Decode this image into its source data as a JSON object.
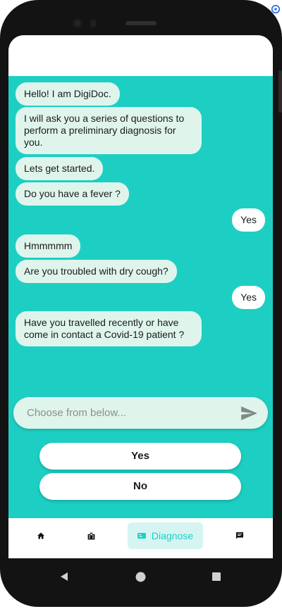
{
  "chat": {
    "messages": [
      {
        "sender": "bot",
        "text": "Hello! I am DigiDoc."
      },
      {
        "sender": "bot",
        "text": "I will ask you a series of questions to perform a preliminary diagnosis for you."
      },
      {
        "sender": "bot",
        "text": "Lets get started."
      },
      {
        "sender": "bot",
        "text": "Do you have a fever ?"
      },
      {
        "sender": "user",
        "text": "Yes"
      },
      {
        "sender": "bot",
        "text": "Hmmmmm"
      },
      {
        "sender": "bot",
        "text": "Are you troubled with dry cough?"
      },
      {
        "sender": "user",
        "text": "Yes"
      },
      {
        "sender": "bot",
        "text": "Have you travelled recently or have come in contact a Covid-19 patient ?"
      }
    ]
  },
  "input": {
    "placeholder": "Choose from below..."
  },
  "options": [
    "Yes",
    "No"
  ],
  "bottom_nav": {
    "items": [
      {
        "icon": "home-icon",
        "label": ""
      },
      {
        "icon": "hospital-icon",
        "label": ""
      },
      {
        "icon": "diagnose-icon",
        "label": "Diagnose"
      },
      {
        "icon": "chat-icon",
        "label": ""
      }
    ],
    "active_index": 2
  },
  "colors": {
    "accent": "#1dcfc3",
    "bot_bubble": "#dff5ec",
    "user_bubble": "#ffffff"
  }
}
